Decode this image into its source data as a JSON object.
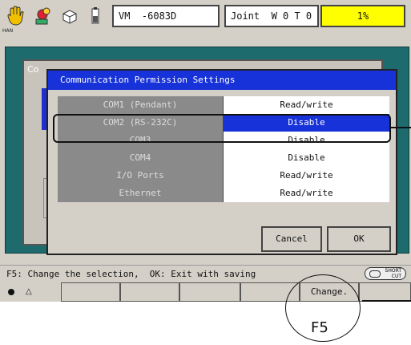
{
  "topbar": {
    "robot_field": "VM  -6083D",
    "coord_field": "Joint  W 0 T 0",
    "speed_field": "1%",
    "han_label": "HAN",
    "icons": [
      "hand-icon",
      "robot-arm-icon",
      "tool-icon",
      "battery-icon"
    ]
  },
  "background_window": {
    "title": "Co"
  },
  "dialog": {
    "title": "Communication Permission Settings",
    "rows": [
      {
        "port": "COM1 (Pendant)",
        "value": "Read/write",
        "selected": false
      },
      {
        "port": "COM2 (RS-232C)",
        "value": "Disable",
        "selected": true
      },
      {
        "port": "COM3",
        "value": "Disable",
        "selected": false
      },
      {
        "port": "COM4",
        "value": "Disable",
        "selected": false
      },
      {
        "port": "I/O Ports",
        "value": "Read/write",
        "selected": false
      },
      {
        "port": "Ethernet",
        "value": "Read/write",
        "selected": false
      }
    ],
    "cancel_label": "Cancel",
    "ok_label": "OK"
  },
  "status_text": "F5: Change the selection,  OK: Exit with saving",
  "shortcut": {
    "line1": "SHORT",
    "line2": "CUT"
  },
  "fkeys": {
    "f5_label": "Change."
  },
  "callout_label": "F5",
  "colors": {
    "selection": "#1732d8",
    "teal": "#1e6b6e",
    "speed_bg": "#ffff00"
  }
}
